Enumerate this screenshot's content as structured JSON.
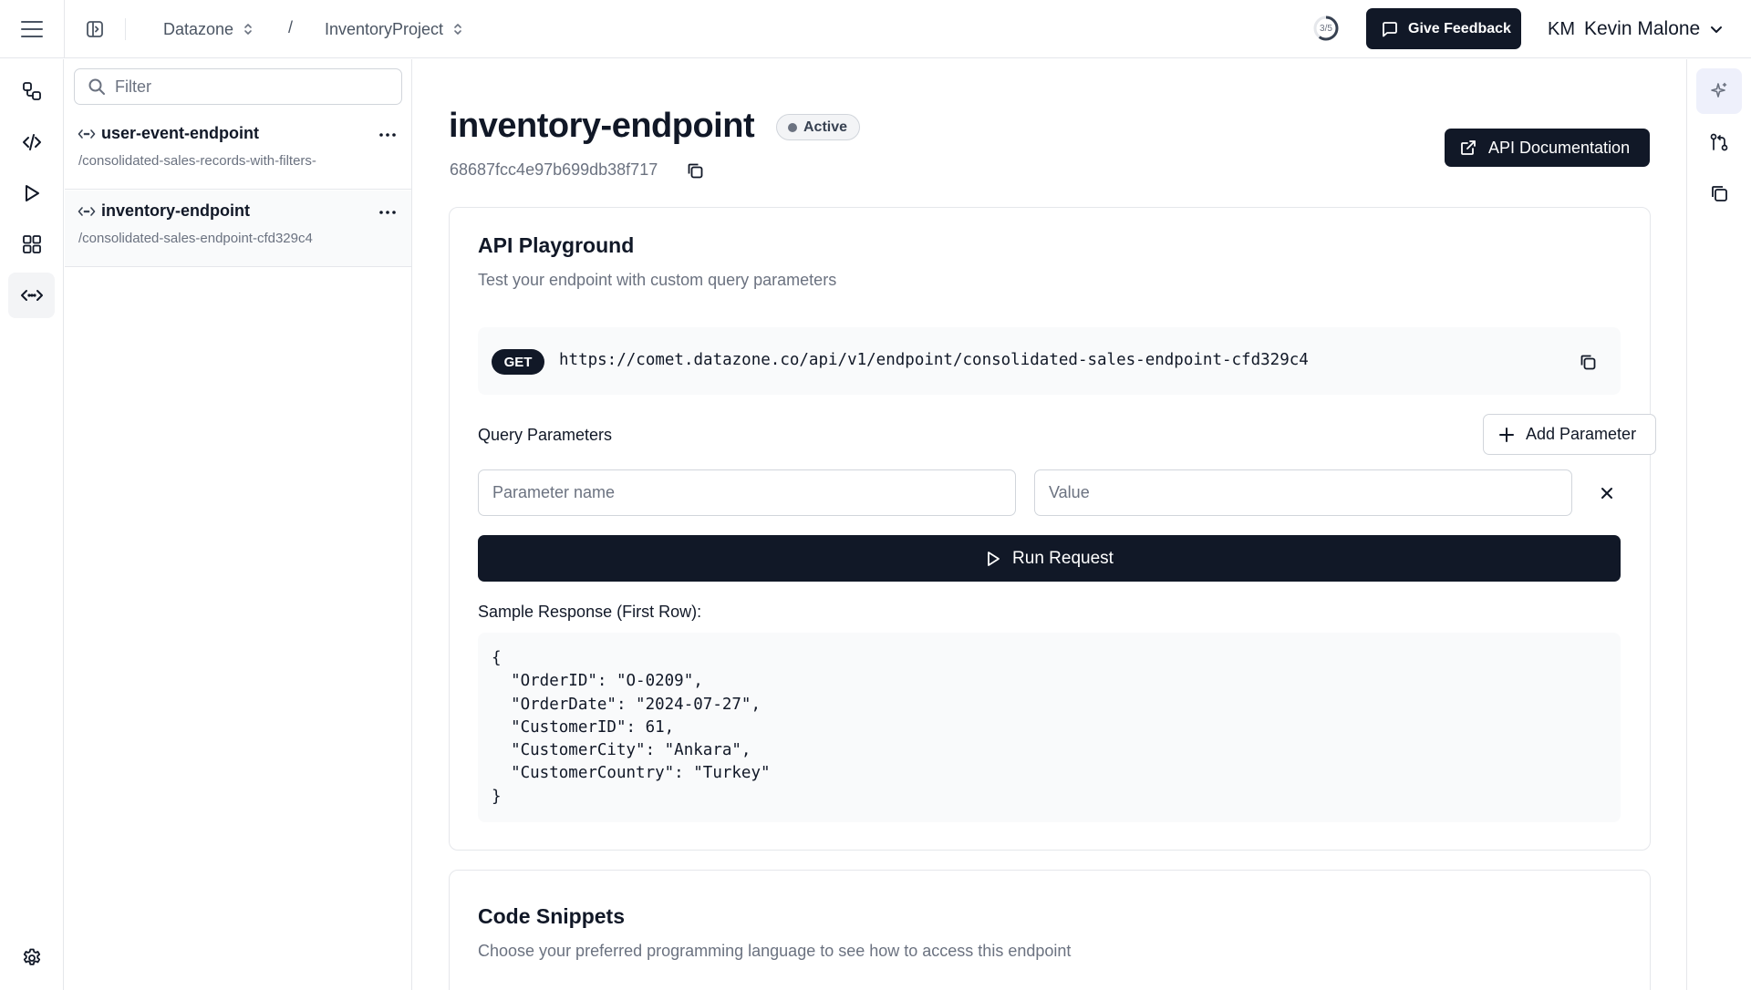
{
  "topbar": {
    "org": "Datazone",
    "separator": "/",
    "project": "InventoryProject",
    "progress": "3/5",
    "progress_fraction": 0.6,
    "feedback_label": "Give Feedback",
    "user_initials": "KM",
    "user_name": "Kevin Malone"
  },
  "rail": {
    "icons": [
      "pipelines-icon",
      "code-icon",
      "play-icon",
      "grid-icon",
      "endpoint-icon",
      "settings-icon"
    ],
    "active": "endpoint-icon"
  },
  "sidebar": {
    "filter_placeholder": "Filter",
    "endpoints": [
      {
        "name": "user-event-endpoint",
        "path": "/consolidated-sales-records-with-filters-"
      },
      {
        "name": "inventory-endpoint",
        "path": "/consolidated-sales-endpoint-cfd329c4"
      }
    ],
    "selected": "inventory-endpoint"
  },
  "main": {
    "title": "inventory-endpoint",
    "status": "Active",
    "endpoint_id": "68687fcc4e97b699db38f717",
    "docs_label": "API Documentation",
    "playground": {
      "title": "API Playground",
      "subtitle": "Test your endpoint with custom query parameters",
      "method": "GET",
      "url": "https://comet.datazone.co/api/v1/endpoint/consolidated-sales-endpoint-cfd329c4",
      "query_params_label": "Query Parameters",
      "add_param_label": "Add Parameter",
      "param_name_placeholder": "Parameter name",
      "param_value_placeholder": "Value",
      "param_name_value": "",
      "param_value_value": "",
      "run_label": "Run Request",
      "response_label": "Sample Response (First Row):",
      "response_json": "{\n  \"OrderID\": \"O-0209\",\n  \"OrderDate\": \"2024-07-27\",\n  \"CustomerID\": 61,\n  \"CustomerCity\": \"Ankara\",\n  \"CustomerCountry\": \"Turkey\"\n}"
    },
    "snippets": {
      "title": "Code Snippets",
      "subtitle": "Choose your preferred programming language to see how to access this endpoint"
    }
  },
  "right_rail": {
    "icons": [
      "sparkle-icon",
      "git-compare-icon",
      "copy-icon"
    ],
    "active": "sparkle-icon"
  },
  "colors": {
    "primary": "#111827",
    "border": "#e5e7eb",
    "muted_text": "#6b7280",
    "active_rail_bg": "#eef0fb"
  }
}
